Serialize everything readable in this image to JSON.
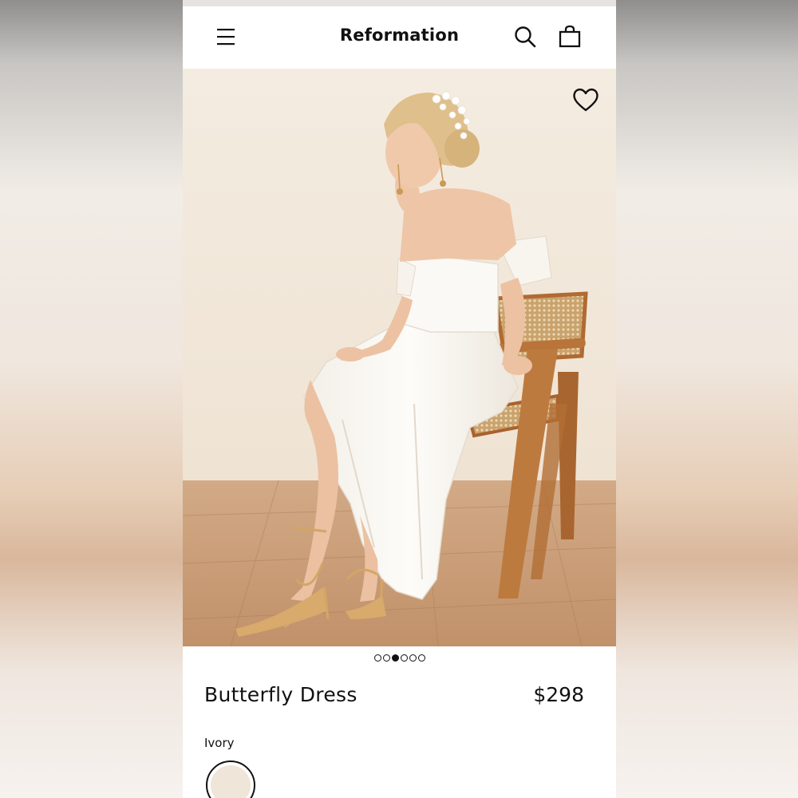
{
  "header": {
    "brand": "Reformation",
    "menu_icon": "hamburger-menu-icon",
    "search_icon": "search-icon",
    "bag_icon": "shopping-bag-icon"
  },
  "hero": {
    "favorite_icon": "heart-icon",
    "carousel": {
      "total": 6,
      "active_index": 2
    }
  },
  "product": {
    "name": "Butterfly Dress",
    "price": "$298",
    "color_name": "Ivory",
    "swatch_color": "#efe5d8"
  },
  "colors": {
    "wall": "#f2e8dc",
    "floor": "#c79a74",
    "dress": "#fbf9f5",
    "chair_wood": "#b9743a",
    "cane": "#d9b98e",
    "skin": "#edc3a5",
    "hair": "#dcbb86",
    "sandals": "#d4a565"
  }
}
